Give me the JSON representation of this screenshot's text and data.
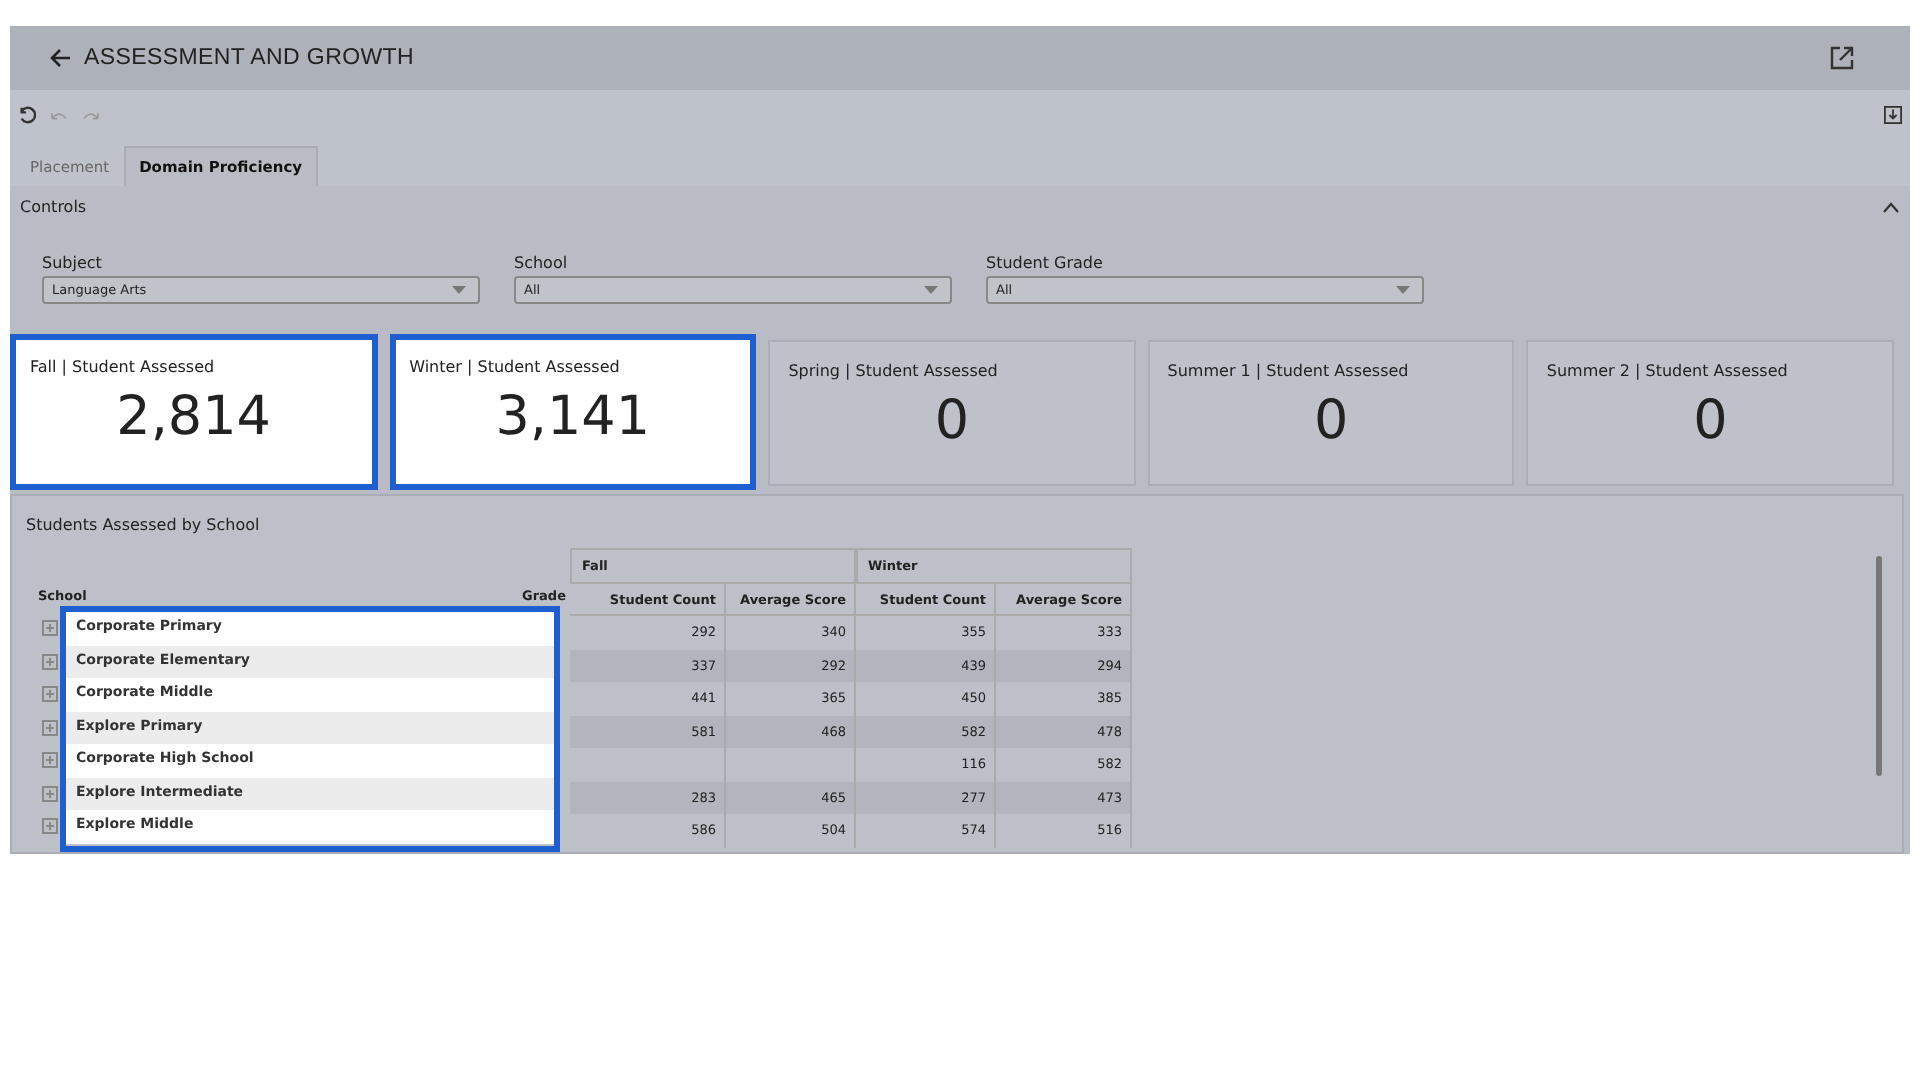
{
  "header": {
    "title": "ASSESSMENT AND GROWTH"
  },
  "tabs": [
    {
      "label": "Placement",
      "selected": false
    },
    {
      "label": "Domain Proficiency",
      "selected": true
    }
  ],
  "controls": {
    "title": "Controls",
    "expanded": true,
    "filters": [
      {
        "label": "Subject",
        "value": "Language Arts"
      },
      {
        "label": "School",
        "value": "All"
      },
      {
        "label": "Student Grade",
        "value": "All"
      }
    ]
  },
  "cards": [
    {
      "title": "Fall | Student Assessed",
      "value": "2,814",
      "highlighted": true
    },
    {
      "title": "Winter | Student Assessed",
      "value": "3,141",
      "highlighted": true
    },
    {
      "title": "Spring | Student Assessed",
      "value": "0",
      "highlighted": false
    },
    {
      "title": "Summer 1 | Student Assessed",
      "value": "0",
      "highlighted": false
    },
    {
      "title": "Summer 2 | Student Assessed",
      "value": "0",
      "highlighted": false
    }
  ],
  "table": {
    "title": "Students Assessed by School",
    "columns": [
      "School",
      "Grade"
    ],
    "groups": [
      {
        "name": "Fall",
        "columns": [
          "Student Count",
          "Average Score"
        ]
      },
      {
        "name": "Winter",
        "columns": [
          "Student Count",
          "Average Score"
        ]
      }
    ],
    "rows": [
      {
        "school": "Corporate Primary",
        "highlighted": true,
        "fall": {
          "student_count": "292",
          "average_score": "340"
        },
        "winter": {
          "student_count": "355",
          "average_score": "333"
        }
      },
      {
        "school": "Corporate Elementary",
        "highlighted": true,
        "fall": {
          "student_count": "337",
          "average_score": "292"
        },
        "winter": {
          "student_count": "439",
          "average_score": "294"
        }
      },
      {
        "school": "Corporate Middle",
        "highlighted": true,
        "fall": {
          "student_count": "441",
          "average_score": "365"
        },
        "winter": {
          "student_count": "450",
          "average_score": "385"
        }
      },
      {
        "school": "Explore Primary",
        "highlighted": true,
        "fall": {
          "student_count": "581",
          "average_score": "468"
        },
        "winter": {
          "student_count": "582",
          "average_score": "478"
        }
      },
      {
        "school": "Corporate High School",
        "highlighted": true,
        "winter": {
          "student_count": "116",
          "average_score": "582"
        }
      },
      {
        "school": "Explore Intermediate",
        "highlighted": true,
        "fall": {
          "student_count": "283",
          "average_score": "465"
        },
        "winter": {
          "student_count": "277",
          "average_score": "473"
        }
      },
      {
        "school": "Explore Middle",
        "highlighted": true,
        "fall": {
          "student_count": "586",
          "average_score": "504"
        },
        "winter": {
          "student_count": "574",
          "average_score": "516"
        }
      }
    ]
  }
}
